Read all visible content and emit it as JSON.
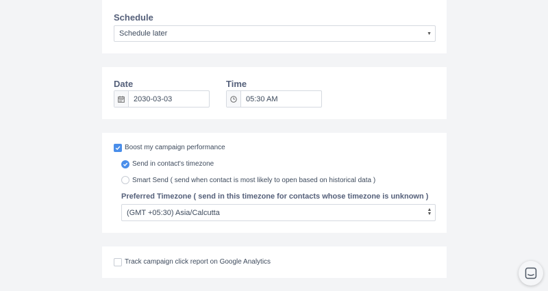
{
  "schedule": {
    "label": "Schedule",
    "selected": "Schedule later"
  },
  "date": {
    "label": "Date",
    "value": "2030-03-03"
  },
  "time": {
    "label": "Time",
    "value": "05:30 AM"
  },
  "boost": {
    "label": "Boost my campaign performance",
    "checked": true,
    "options": [
      {
        "label": "Send in contact's timezone",
        "selected": true
      },
      {
        "label": "Smart Send ( send when contact is most likely to open based on historical data )",
        "selected": false
      }
    ],
    "timezone_label": "Preferred Timezone ( send in this timezone for contacts whose timezone is unknown )",
    "timezone_selected": "(GMT +05:30) Asia/Calcutta"
  },
  "analytics": {
    "label": "Track campaign click report on Google Analytics",
    "checked": false
  },
  "colors": {
    "accent": "#4a8eea",
    "background": "#f3f4f6",
    "card": "#ffffff"
  },
  "icons": {
    "date": "calendar-icon",
    "time": "clock-icon",
    "chat": "chat-bubble-icon"
  }
}
